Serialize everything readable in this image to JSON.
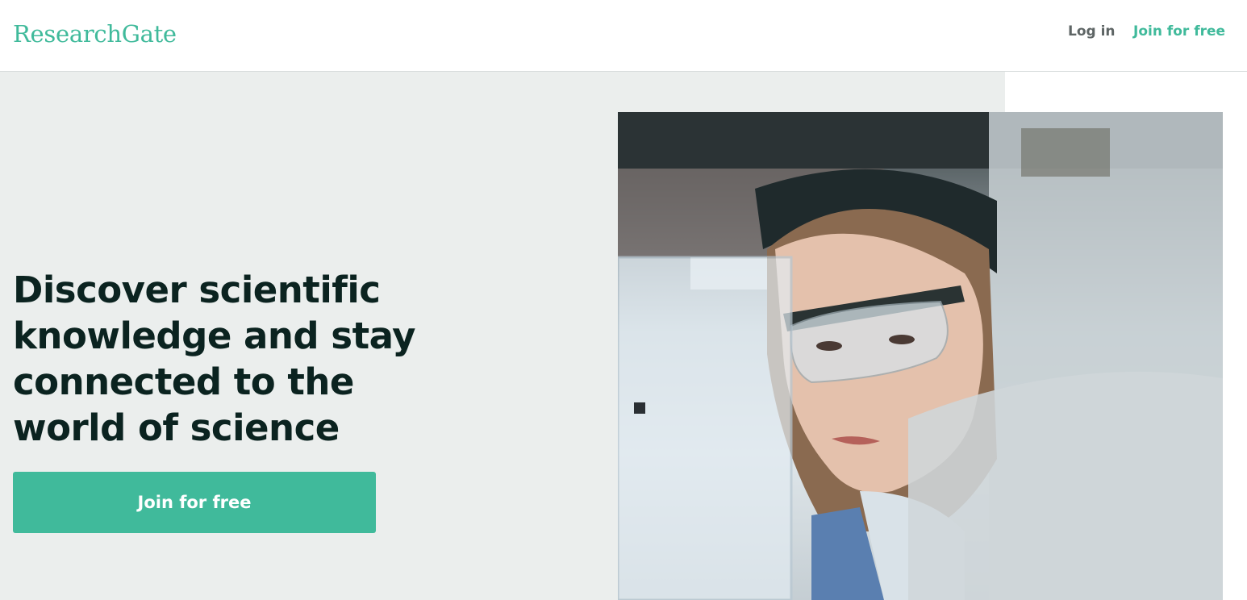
{
  "header": {
    "logo": "ResearchGate",
    "login_label": "Log in",
    "join_label": "Join for free"
  },
  "hero": {
    "headline": "Discover scientific knowledge and stay connected to the world of science",
    "cta_label": "Join for free"
  },
  "colors": {
    "brand_green": "#40ba9b",
    "hero_background": "#ebeeed",
    "headline_text": "#0b2320",
    "nav_text": "#5e6565"
  }
}
